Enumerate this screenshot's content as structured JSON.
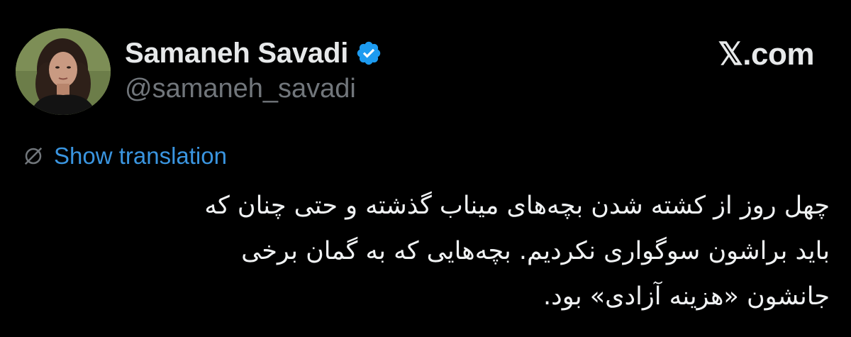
{
  "author": {
    "display_name": "Samaneh Savadi",
    "handle": "@samaneh_savadi",
    "verified": true,
    "avatar_icon": "profile-photo"
  },
  "brand": {
    "text": "𝕏.com"
  },
  "translation": {
    "label": "Show translation",
    "icon": "globe-icon"
  },
  "tweet": {
    "lines": [
      "چهل روز از کشته شدن بچه‌های میناب گذشته و حتی چنان که",
      "باید براشون سوگواری نکردیم. بچه‌هایی که به گمان برخی",
      "جانشون «هزینه آزادی» بود."
    ]
  },
  "colors": {
    "background": "#000000",
    "text": "#e7e9ea",
    "muted": "#71767b",
    "link": "#3a95e0",
    "verified_badge": "#1d9bf0"
  }
}
